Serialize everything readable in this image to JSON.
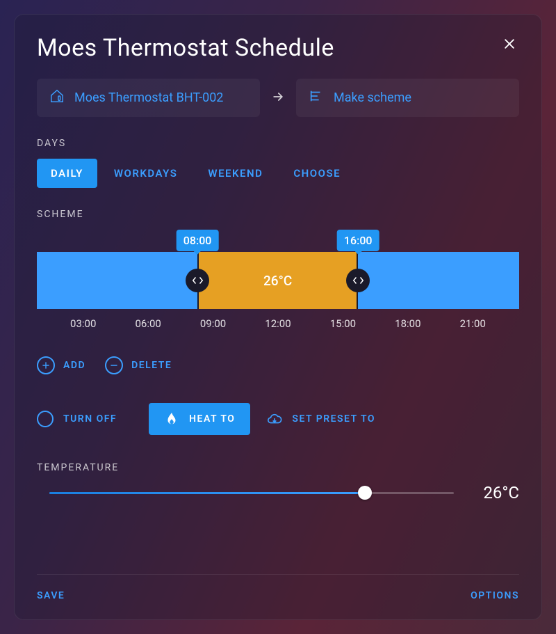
{
  "title": "Moes Thermostat Schedule",
  "breadcrumb": {
    "device": "Moes Thermostat BHT-002",
    "action": "Make scheme"
  },
  "sections": {
    "days": "DAYS",
    "scheme": "SCHEME",
    "temperature": "TEMPERATURE"
  },
  "days_tabs": {
    "daily": "DAILY",
    "workdays": "WORKDAYS",
    "weekend": "WEEKEND",
    "choose": "CHOOSE",
    "active": "daily"
  },
  "scheme": {
    "start_badge": "08:00",
    "end_badge": "16:00",
    "segments": [
      {
        "width_pct": 33.3,
        "color": "blue",
        "label": ""
      },
      {
        "width_pct": 33.3,
        "color": "orange",
        "label": "26°C"
      },
      {
        "width_pct": 33.4,
        "color": "blue",
        "label": ""
      }
    ],
    "axis": [
      "03:00",
      "06:00",
      "09:00",
      "12:00",
      "15:00",
      "18:00",
      "21:00"
    ]
  },
  "scheme_actions": {
    "add": "ADD",
    "delete": "DELETE"
  },
  "mode": {
    "turn_off": "TURN OFF",
    "heat_to": "HEAT TO",
    "set_preset_to": "SET PRESET TO",
    "active": "heat_to"
  },
  "temperature": {
    "value_label": "26°C",
    "slider_pct": 78
  },
  "footer": {
    "save": "SAVE",
    "options": "OPTIONS"
  },
  "colors": {
    "accent": "#2196f3",
    "link": "#3b9eff",
    "heat": "#e6a023"
  }
}
